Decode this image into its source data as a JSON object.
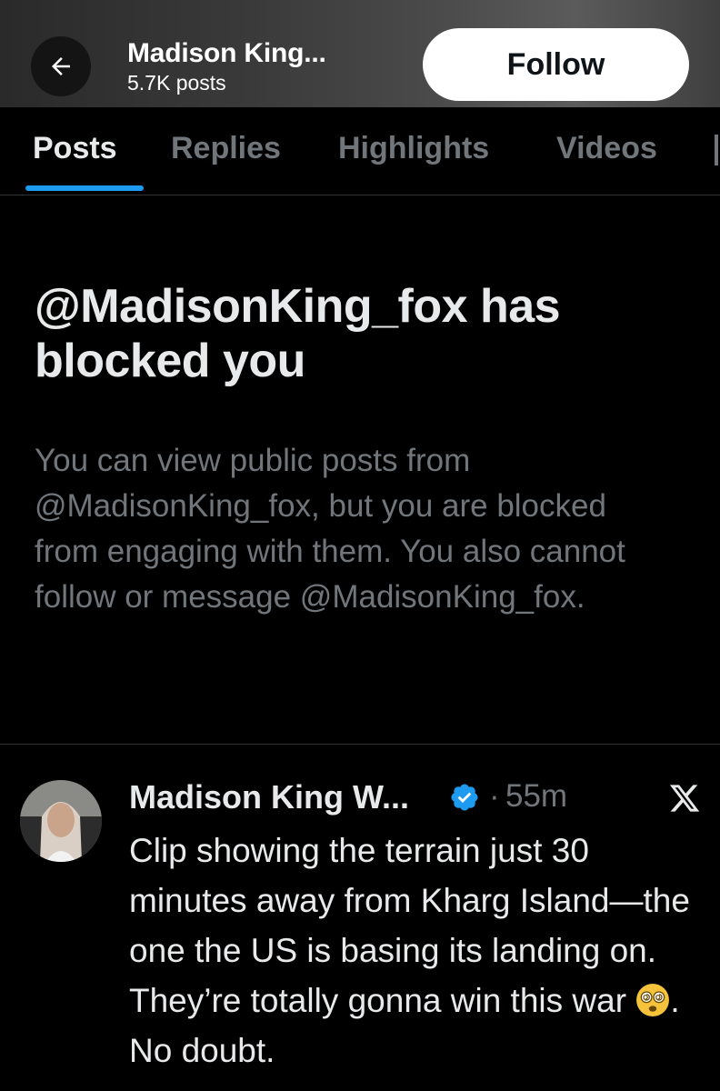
{
  "header": {
    "name": "Madison King...",
    "post_count": "5.7K posts",
    "follow_label": "Follow",
    "back_icon": "arrow-left-icon"
  },
  "tabs": [
    {
      "label": "Posts",
      "active": true
    },
    {
      "label": "Replies",
      "active": false
    },
    {
      "label": "Highlights",
      "active": false
    },
    {
      "label": "Videos",
      "active": false
    }
  ],
  "blocked": {
    "title": "@MadisonKing_fox has blocked you",
    "body": "You can view public posts from @MadisonKing_fox, but you are blocked from engaging with them. You also cannot follow or message @MadisonKing_fox."
  },
  "post": {
    "author": "Madison King W...",
    "separator": "·",
    "time": "55m",
    "text_before_emoji": "Clip showing the terrain just 30 minutes away from Kharg Island—the one the US is basing its landing on. They’re totally gonna win this war ",
    "emoji": "dizzy-face-emoji",
    "text_after_emoji": ". No doubt.",
    "verified_icon": "verified-badge-icon",
    "brand_icon": "x-logo-icon"
  },
  "colors": {
    "background": "#000000",
    "primary_text": "#e7e9ea",
    "secondary_text": "#71767b",
    "accent": "#1d9bf0",
    "divider": "#2f3336"
  }
}
